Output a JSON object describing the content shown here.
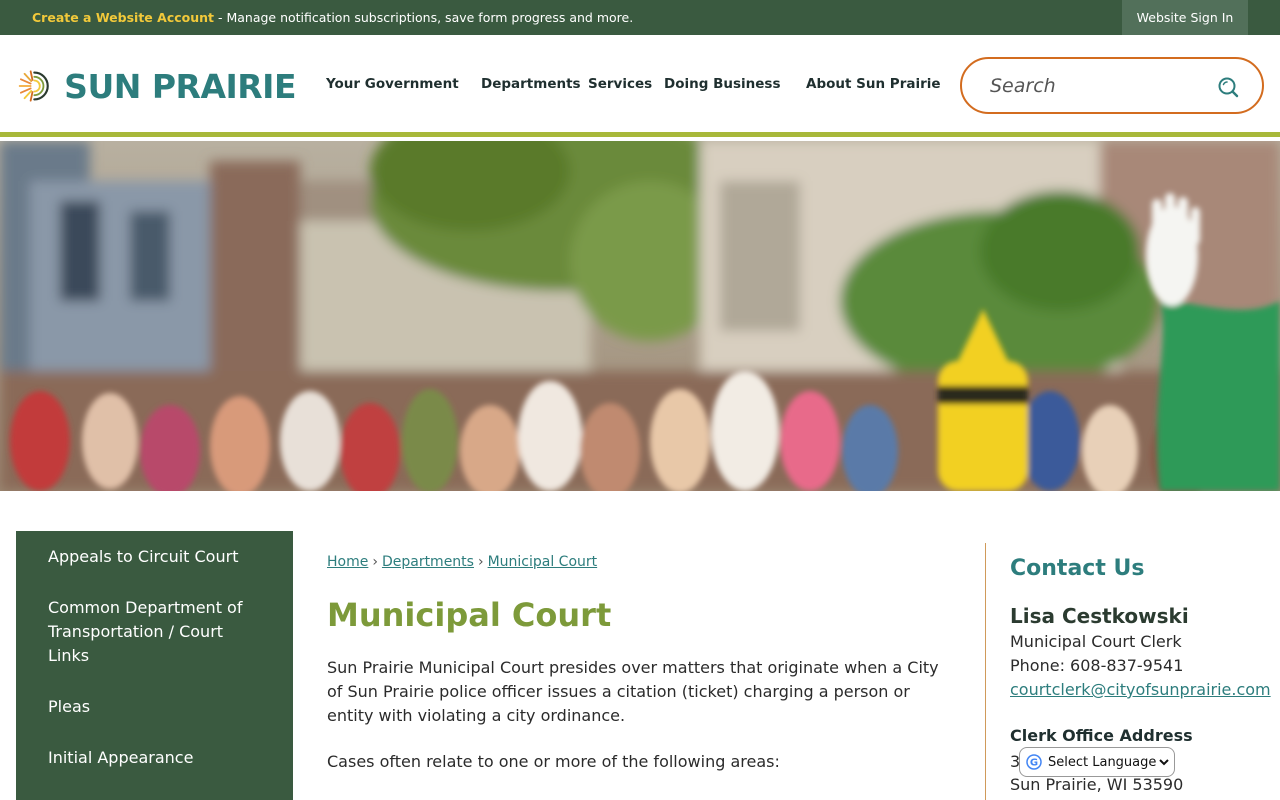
{
  "topbar": {
    "create_account_link": "Create a Website Account",
    "message": " - Manage notification subscriptions, save form progress and more.",
    "sign_in": "Website Sign In"
  },
  "header": {
    "logo_text": "SUN PRAIRIE",
    "nav": [
      {
        "label": "Your Government"
      },
      {
        "label": "Departments"
      },
      {
        "label": "Services"
      },
      {
        "label": "Doing Business"
      },
      {
        "label": "About Sun Prairie"
      }
    ],
    "search_placeholder": "Search"
  },
  "colors": {
    "brand_green": "#3a5a40",
    "accent_teal": "#2d7d7d",
    "title_olive": "#7d9a3a",
    "search_orange": "#d36c1f",
    "link_yellow": "#f2c93a"
  },
  "sidebar": {
    "items": [
      {
        "label": "Appeals to Circuit Court"
      },
      {
        "label": "Common Department of Transportation / Court Links"
      },
      {
        "label": "Pleas"
      },
      {
        "label": "Initial Appearance"
      }
    ]
  },
  "main": {
    "breadcrumb": [
      {
        "label": "Home"
      },
      {
        "label": "Departments"
      },
      {
        "label": "Municipal Court"
      }
    ],
    "breadcrumb_sep": "›",
    "title": "Municipal Court",
    "paragraph1": "Sun Prairie Municipal Court presides over matters that originate when a City of Sun Prairie police officer issues a citation (ticket) charging a person or entity with violating a city ordinance.",
    "paragraph2": "Cases often relate to one or more of the following areas:"
  },
  "contact": {
    "heading": "Contact Us",
    "name": "Lisa Cestkowski",
    "role": "Municipal Court Clerk",
    "phone": "Phone: 608-837-9541",
    "email": "courtclerk@cityofsunprairie.com",
    "address_heading": "Clerk Office Address",
    "address_line1_partial": "3",
    "address_line2": "Sun Prairie, WI 53590"
  },
  "translate": {
    "selected": "Select Language"
  },
  "icons": {
    "search": "search-icon",
    "logo_sun": "sun-logo-icon",
    "google": "google-g-icon"
  }
}
